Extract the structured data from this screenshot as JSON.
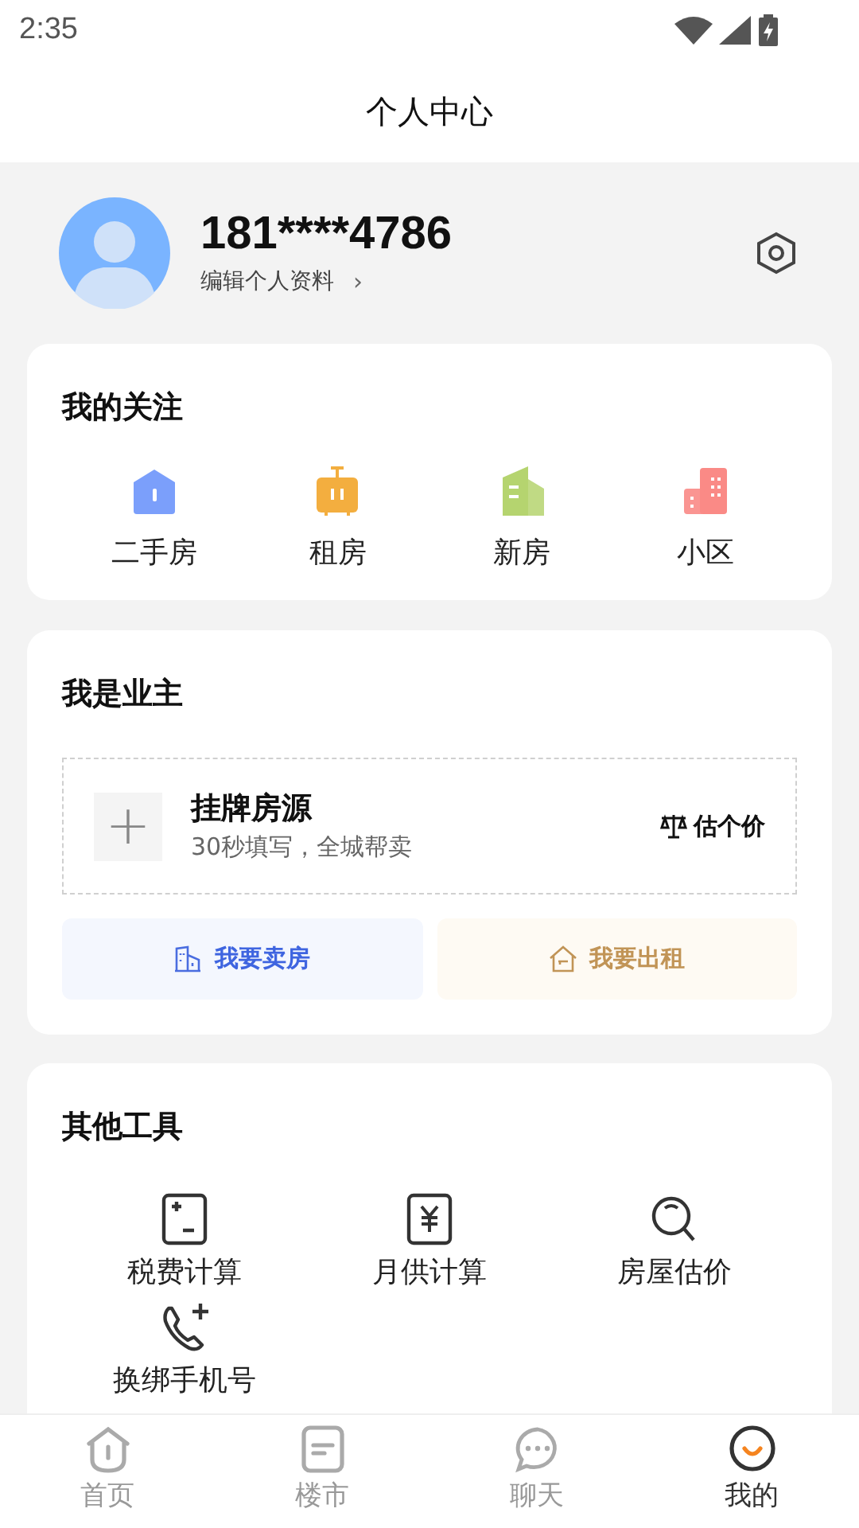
{
  "status_bar": {
    "time": "2:35"
  },
  "header": {
    "title": "个人中心"
  },
  "profile": {
    "phone": "181****4786",
    "edit_link": "编辑个人资料",
    "chevron": "›"
  },
  "follow": {
    "title": "我的关注",
    "items": [
      {
        "label": "二手房",
        "kind": "house",
        "color": "#7b9ffb"
      },
      {
        "label": "租房",
        "kind": "suitcase",
        "color": "#f3ae3f"
      },
      {
        "label": "新房",
        "kind": "building",
        "color": "#b5d46f"
      },
      {
        "label": "小区",
        "kind": "blocks",
        "color": "#fa8a86"
      }
    ]
  },
  "owner": {
    "title": "我是业主",
    "listing": {
      "plus": "+",
      "title": "挂牌房源",
      "subtitle": "30秒填写，全城帮卖",
      "estimate": "估个价"
    },
    "buttons": [
      {
        "label": "我要卖房",
        "kind": "sell"
      },
      {
        "label": "我要出租",
        "kind": "rent"
      }
    ]
  },
  "tools": {
    "title": "其他工具",
    "items": [
      {
        "label": "税费计算",
        "kind": "calc"
      },
      {
        "label": "月供计算",
        "kind": "yen"
      },
      {
        "label": "房屋估价",
        "kind": "search"
      },
      {
        "label": "换绑手机号",
        "kind": "phone"
      }
    ]
  },
  "tab_bar": [
    {
      "label": "首页",
      "kind": "home",
      "selected": false
    },
    {
      "label": "楼市",
      "kind": "doc",
      "selected": false
    },
    {
      "label": "聊天",
      "kind": "chat",
      "selected": false
    },
    {
      "label": "我的",
      "kind": "me",
      "selected": true
    }
  ]
}
